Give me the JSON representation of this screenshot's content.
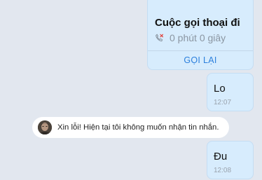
{
  "call_card": {
    "title": "Cuộc gọi thoại đi",
    "duration": "0 phút 0 giây",
    "callback_label": "GỌI LẠI",
    "icon": "outgoing-missed-call-icon"
  },
  "messages": [
    {
      "text": "Lo",
      "time": "12:07"
    },
    {
      "text": "Đu",
      "time": "12:08"
    }
  ],
  "auto_reply": {
    "text": "Xin lỗi! Hiện tại tôi không muốn nhận tin nhắn.",
    "avatar": "user-avatar"
  },
  "colors": {
    "background": "#e2e7ef",
    "bubble": "#d7ecfd",
    "accent": "#2b7fdc",
    "missed_call_red": "#e0453f"
  }
}
